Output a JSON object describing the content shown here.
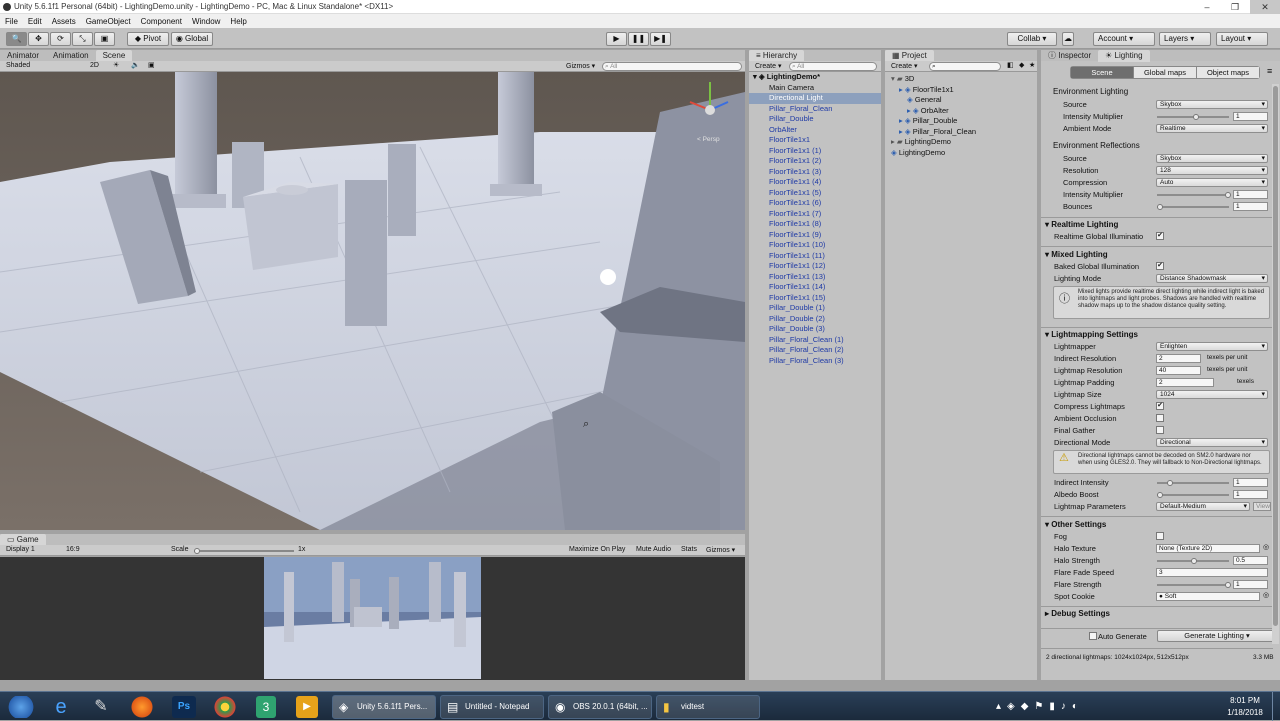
{
  "window": {
    "title": "Unity 5.6.1f1 Personal (64bit) - LightingDemo.unity - LightingDemo - PC, Mac & Linux Standalone* <DX11>"
  },
  "menu": [
    "File",
    "Edit",
    "Assets",
    "GameObject",
    "Component",
    "Window",
    "Help"
  ],
  "toolbar": {
    "pivot": "Pivot",
    "global": "Global",
    "collab": "Collab ▾",
    "account": "Account",
    "layers": "Layers",
    "layout": "Layout"
  },
  "scene": {
    "tabs": [
      "Animator",
      "Animation",
      "Scene"
    ],
    "shading": "Shaded",
    "mode_2d": "2D",
    "gizmos": "Gizmos ▾",
    "search_placeholder": "All",
    "persp": "< Persp"
  },
  "game": {
    "tab": "Game",
    "display": "Display 1",
    "aspect": "16:9",
    "scale_label": "Scale",
    "scale_value": "1x",
    "maximize": "Maximize On Play",
    "mute": "Mute Audio",
    "stats": "Stats",
    "gizmos": "Gizmos ▾"
  },
  "hierarchy": {
    "tab": "Hierarchy",
    "create": "Create ▾",
    "search_placeholder": "All",
    "root": "LightingDemo*",
    "items": [
      "Main Camera",
      "Directional Light",
      "Pillar_Floral_Clean",
      "Pillar_Double",
      "OrbAlter",
      "FloorTile1x1",
      "FloorTile1x1 (1)",
      "FloorTile1x1 (2)",
      "FloorTile1x1 (3)",
      "FloorTile1x1 (4)",
      "FloorTile1x1 (5)",
      "FloorTile1x1 (6)",
      "FloorTile1x1 (7)",
      "FloorTile1x1 (8)",
      "FloorTile1x1 (9)",
      "FloorTile1x1 (10)",
      "FloorTile1x1 (11)",
      "FloorTile1x1 (12)",
      "FloorTile1x1 (13)",
      "FloorTile1x1 (14)",
      "FloorTile1x1 (15)",
      "Pillar_Double (1)",
      "Pillar_Double (2)",
      "Pillar_Double (3)",
      "Pillar_Floral_Clean (1)",
      "Pillar_Floral_Clean (2)",
      "Pillar_Floral_Clean (3)"
    ]
  },
  "project": {
    "tab": "Project",
    "create": "Create ▾",
    "items": [
      "3D",
      "FloorTile1x1",
      "General",
      "OrbAlter",
      "Pillar_Double",
      "Pillar_Floral_Clean",
      "LightingDemo",
      "LightingDemo"
    ]
  },
  "inspector": {
    "tab_inspector": "Inspector",
    "tab_lighting": "Lighting",
    "subtabs": [
      "Scene",
      "Global maps",
      "Object maps"
    ],
    "env_lighting": "Environment Lighting",
    "source": "Source",
    "skybox": "Skybox",
    "intensity_multiplier": "Intensity Multiplier",
    "one": "1",
    "ambient_mode": "Ambient Mode",
    "realtime": "Realtime",
    "env_reflections": "Environment Reflections",
    "resolution": "Resolution",
    "res_val": "128",
    "compression": "Compression",
    "auto": "Auto",
    "bounces": "Bounces",
    "realtime_lighting": "Realtime Lighting",
    "realtime_gi": "Realtime Global Illuminatio",
    "mixed_lighting": "Mixed Lighting",
    "baked_gi": "Baked Global Illumination",
    "lighting_mode": "Lighting Mode",
    "lighting_mode_val": "Distance Shadowmask",
    "mixed_help": "Mixed lights provide realtime direct lighting while indirect light is baked into lightmaps and light probes. Shadows are handled with realtime shadow maps up to the shadow distance quality setting.",
    "lightmapping_settings": "Lightmapping Settings",
    "lightmapper": "Lightmapper",
    "lightmapper_val": "Enlighten",
    "indirect_resolution": "Indirect Resolution",
    "indirect_res_val": "2",
    "texels_per_unit": "texels per unit",
    "lightmap_resolution": "Lightmap Resolution",
    "lightmap_res_val": "40",
    "lightmap_padding": "Lightmap Padding",
    "padding_val": "2",
    "texels": "texels",
    "lightmap_size": "Lightmap Size",
    "size_val": "1024",
    "compress_lightmaps": "Compress Lightmaps",
    "ambient_occlusion": "Ambient Occlusion",
    "final_gather": "Final Gather",
    "directional_mode": "Directional Mode",
    "directional_val": "Directional",
    "dir_help": "Directional lightmaps cannot be decoded on SM2.0 hardware nor when using GLES2.0. They will fallback to Non-Directional lightmaps.",
    "indirect_intensity": "Indirect Intensity",
    "albedo_boost": "Albedo Boost",
    "lightmap_parameters": "Lightmap Parameters",
    "params_val": "Default-Medium",
    "view": "View",
    "other_settings": "Other Settings",
    "fog": "Fog",
    "halo_texture": "Halo Texture",
    "halo_texture_val": "None (Texture 2D)",
    "halo_strength": "Halo Strength",
    "halo_strength_val": "0.5",
    "flare_fade_speed": "Flare Fade Speed",
    "flare_fade_val": "3",
    "flare_strength": "Flare Strength",
    "spot_cookie": "Spot Cookie",
    "spot_cookie_val": "Soft",
    "debug_settings": "Debug Settings",
    "auto_generate": "Auto Generate",
    "generate_lighting": "Generate Lighting",
    "status": "2 directional lightmaps: 1024x1024px, 512x512px",
    "size_mb": "3.3 MB"
  },
  "taskbar": {
    "apps": [
      "Unity 5.6.1f1 Pers...",
      "Untitled - Notepad",
      "OBS 20.0.1 (64bit, ...",
      "vidtest"
    ],
    "time": "8:01 PM",
    "date": "1/18/2018"
  },
  "colors": {
    "selection": "#8da0bd",
    "link": "#1f3aa6",
    "panel": "#c2c2c2"
  }
}
